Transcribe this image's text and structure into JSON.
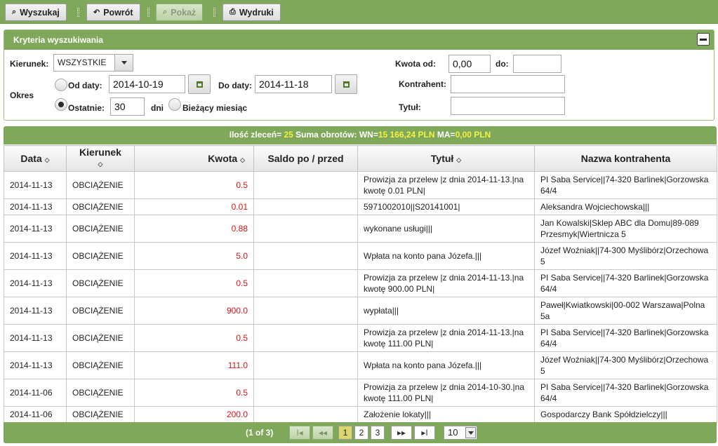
{
  "toolbar": {
    "search": "Wyszukaj",
    "back": "Powrót",
    "show": "Pokaż",
    "prints": "Wydruki"
  },
  "criteria": {
    "title": "Kryteria wyszukiwania",
    "direction_label": "Kierunek:",
    "direction_value": "WSZYSTKIE",
    "period_label": "Okres",
    "from_date_label": "Od daty:",
    "from_date_value": "2014-10-19",
    "to_date_label": "Do daty:",
    "to_date_value": "2014-11-18",
    "last_label": "Ostatnie:",
    "last_value": "30",
    "days_label": "dni",
    "current_month_label": "Bieżący miesiąc",
    "amount_from_label": "Kwota od:",
    "amount_from_value": "0,00",
    "amount_to_label": "do:",
    "amount_to_value": "",
    "contractor_label": "Kontrahent:",
    "contractor_value": "",
    "title_label": "Tytuł:",
    "title_value": ""
  },
  "summary": {
    "count_label": "Ilość zleceń=",
    "count_value": "25",
    "turnover_label": "Suma obrotów:",
    "wn_label": "WN=",
    "wn_value": "15 166,24 PLN",
    "ma_label": "MA=",
    "ma_value": "0,00 PLN"
  },
  "table": {
    "headers": [
      "Data",
      "Kierunek",
      "Kwota",
      "Saldo po / przed",
      "Tytuł",
      "Nazwa kontrahenta"
    ],
    "rows": [
      {
        "date": "2014-11-13",
        "direction": "OBCIĄŻENIE",
        "amount": "0.5",
        "balance": "",
        "title": "Prowizja za przelew |z dnia 2014-11-13.|na kwotę 0.01 PLN|",
        "contractor": "PI Saba Service||74-320 Barlinek|Gorzowska 64/4"
      },
      {
        "date": "2014-11-13",
        "direction": "OBCIĄŻENIE",
        "amount": "0.01",
        "balance": "",
        "title": "5971002010||S20141001|",
        "contractor": "Aleksandra Wojciechowska|||"
      },
      {
        "date": "2014-11-13",
        "direction": "OBCIĄŻENIE",
        "amount": "0.88",
        "balance": "",
        "title": "wykonane usługi|||",
        "contractor": "Jan Kowalski|Sklep ABC dla Domu|89-089 Przesmyk|Wiertnicza 5"
      },
      {
        "date": "2014-11-13",
        "direction": "OBCIĄŻENIE",
        "amount": "5.0",
        "balance": "",
        "title": "Wpłata na konto pana Józefa.|||",
        "contractor": "Józef Woźniak||74-300 Myślibórz|Orzechowa 5"
      },
      {
        "date": "2014-11-13",
        "direction": "OBCIĄŻENIE",
        "amount": "0.5",
        "balance": "",
        "title": "Prowizja za przelew |z dnia 2014-11-13.|na kwotę 900.00 PLN|",
        "contractor": "PI Saba Service||74-320 Barlinek|Gorzowska 64/4"
      },
      {
        "date": "2014-11-13",
        "direction": "OBCIĄŻENIE",
        "amount": "900.0",
        "balance": "",
        "title": "wypłata|||",
        "contractor": "Paweł|Kwiatkowski|00-002 Warszawa|Polna 5a"
      },
      {
        "date": "2014-11-13",
        "direction": "OBCIĄŻENIE",
        "amount": "0.5",
        "balance": "",
        "title": "Prowizja za przelew |z dnia 2014-11-13.|na kwotę 111.00 PLN|",
        "contractor": "PI Saba Service||74-320 Barlinek|Gorzowska 64/4"
      },
      {
        "date": "2014-11-13",
        "direction": "OBCIĄŻENIE",
        "amount": "111.0",
        "balance": "",
        "title": "Wpłata na konto pana Józefa.|||",
        "contractor": "Józef Woźniak||74-300 Myślibórz|Orzechowa 5"
      },
      {
        "date": "2014-11-06",
        "direction": "OBCIĄŻENIE",
        "amount": "0.5",
        "balance": "",
        "title": "Prowizja za przelew |z dnia 2014-10-30.|na kwotę 111.00 PLN|",
        "contractor": "PI Saba Service||74-320 Barlinek|Gorzowska 64/4"
      },
      {
        "date": "2014-11-06",
        "direction": "OBCIĄŻENIE",
        "amount": "200.0",
        "balance": "",
        "title": "Założenie lokaty|||",
        "contractor": "Gospodarczy Bank Spółdzielczy|||"
      }
    ]
  },
  "pager": {
    "status": "(1 of 3)",
    "first": "I◂",
    "prev": "◂◂",
    "pages": [
      "1",
      "2",
      "3"
    ],
    "next": "▸▸",
    "last": "▸I",
    "rows_per_page": "10"
  },
  "colors": {
    "accent_green": "#80a85a",
    "amount_red": "#e01010",
    "summary_yellow": "#f5f044"
  }
}
